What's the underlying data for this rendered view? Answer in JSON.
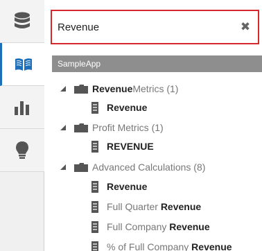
{
  "rail": {
    "items": [
      {
        "icon": "database-icon",
        "active": false
      },
      {
        "icon": "book-icon",
        "active": true
      },
      {
        "icon": "bar-chart-icon",
        "active": false
      },
      {
        "icon": "lightbulb-icon",
        "active": false
      }
    ]
  },
  "search": {
    "value": "Revenue",
    "clear_glyph": "✖"
  },
  "tree": {
    "header": "SampleApp",
    "rows": [
      {
        "type": "folder",
        "match": "Revenue",
        "rest": " Metrics (1)"
      },
      {
        "type": "column",
        "prefix": "",
        "match": "Revenue"
      },
      {
        "type": "folder",
        "match": "",
        "rest": "Profit Metrics (1)"
      },
      {
        "type": "column",
        "prefix": "",
        "match": "REVENUE"
      },
      {
        "type": "folder",
        "match": "",
        "rest": "Advanced Calculations (8)"
      },
      {
        "type": "column",
        "prefix": "",
        "match": "Revenue"
      },
      {
        "type": "column",
        "prefix": "Full Quarter ",
        "match": "Revenue"
      },
      {
        "type": "column",
        "prefix": "Full Company ",
        "match": "Revenue"
      },
      {
        "type": "column",
        "prefix": "% of Full Company ",
        "match": "Revenue"
      }
    ]
  },
  "colors": {
    "search_border": "#d8262f",
    "rail_active": "#1c6fb8",
    "header_bg": "#8e8e8e"
  }
}
